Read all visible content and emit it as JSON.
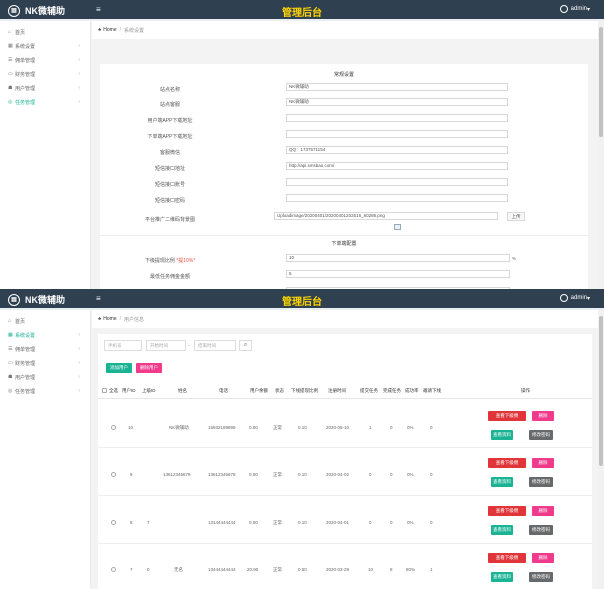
{
  "app": {
    "logo": "NK微辅助",
    "title": "管理后台",
    "user": "admin",
    "colors": {
      "topbar": "#2f4050",
      "title": "#ffd400",
      "accent": "#1ab394",
      "danger": "#ed5565"
    }
  },
  "sidebar": {
    "items": [
      {
        "label": "首页",
        "icon": "home-icon"
      },
      {
        "label": "系统设置",
        "icon": "settings-icon"
      },
      {
        "label": "佣单管理",
        "icon": "list-icon"
      },
      {
        "label": "财务管理",
        "icon": "finance-icon"
      },
      {
        "label": "用户管理",
        "icon": "users-icon"
      },
      {
        "label": "任务管理",
        "icon": "tasks-icon"
      }
    ]
  },
  "settings_page": {
    "breadcrumb": {
      "home": "Home",
      "current": "系统设置"
    },
    "section_basic": "常规设置",
    "rows": [
      {
        "label": "站点名称",
        "value": "NK微辅助"
      },
      {
        "label": "站点客服",
        "value": "NK微辅助"
      },
      {
        "label": "用户端APP下载地址",
        "value": ""
      },
      {
        "label": "下单端APP下载地址",
        "value": ""
      },
      {
        "label": "客服微信",
        "value": "QQ：1737571154"
      },
      {
        "label": "短信接口地址",
        "value": "http://api.smsbao.com/"
      },
      {
        "label": "短信接口账号",
        "value": ""
      },
      {
        "label": "短信接口密码",
        "value": ""
      }
    ],
    "qr_label": "平台推广二维码背景图",
    "qr_path": "Uploadimage/20200401/20200401202516_60286.png",
    "upload_label": "上传",
    "section_order": "下单端配置",
    "rate_label": "下级提现比例",
    "rate_hint": "*提10%*",
    "rate_value": "10",
    "rate_unit": "%",
    "commission_label": "最低任务佣金金额",
    "commission_value": "5"
  },
  "users_page": {
    "breadcrumb": {
      "home": "Home",
      "current": "用户信息"
    },
    "filters": {
      "phone": "手机号",
      "start": "开始时间",
      "dash": "-",
      "end": "结束时间"
    },
    "add_button": "添加用户",
    "delete_button": "删除用户",
    "headers": [
      "全选",
      "用户ID",
      "上级ID",
      "姓名",
      "电话",
      "用户余额",
      "状态",
      "下线提现比例",
      "注册时间",
      "提交任务",
      "完成任务",
      "成功率",
      "邀请下线",
      "操作"
    ],
    "actions": {
      "view_subs": "查看下级佣",
      "delete": "删除",
      "view_funds": "查看资料",
      "edit_password": "修改密码"
    },
    "rows": [
      {
        "id": "10",
        "parent": "",
        "name": "NK微辅助",
        "phone": "15932189899",
        "balance": "0.00",
        "status": "正常",
        "rate": "0.10",
        "reg": "2020-05-10",
        "submit": "1",
        "done": "0",
        "success": "0%",
        "invite": "0"
      },
      {
        "id": "9",
        "parent": "",
        "name": "13612345678",
        "phone": "13612345678",
        "balance": "0.00",
        "status": "正常",
        "rate": "0.10",
        "reg": "2020-04-02",
        "submit": "0",
        "done": "0",
        "success": "0%",
        "invite": "0"
      },
      {
        "id": "8",
        "parent": "7",
        "name": "",
        "phone": "13144444444",
        "balance": "0.00",
        "status": "正常",
        "rate": "0.10",
        "reg": "2020-04-01",
        "submit": "0",
        "done": "0",
        "success": "0%",
        "invite": "0"
      },
      {
        "id": "7",
        "parent": "0",
        "name": "无名",
        "phone": "13444444444",
        "balance": "20.90",
        "status": "正常",
        "rate": "0.50",
        "reg": "2020-03-29",
        "submit": "10",
        "done": "8",
        "success": "80%",
        "invite": "1"
      }
    ]
  }
}
